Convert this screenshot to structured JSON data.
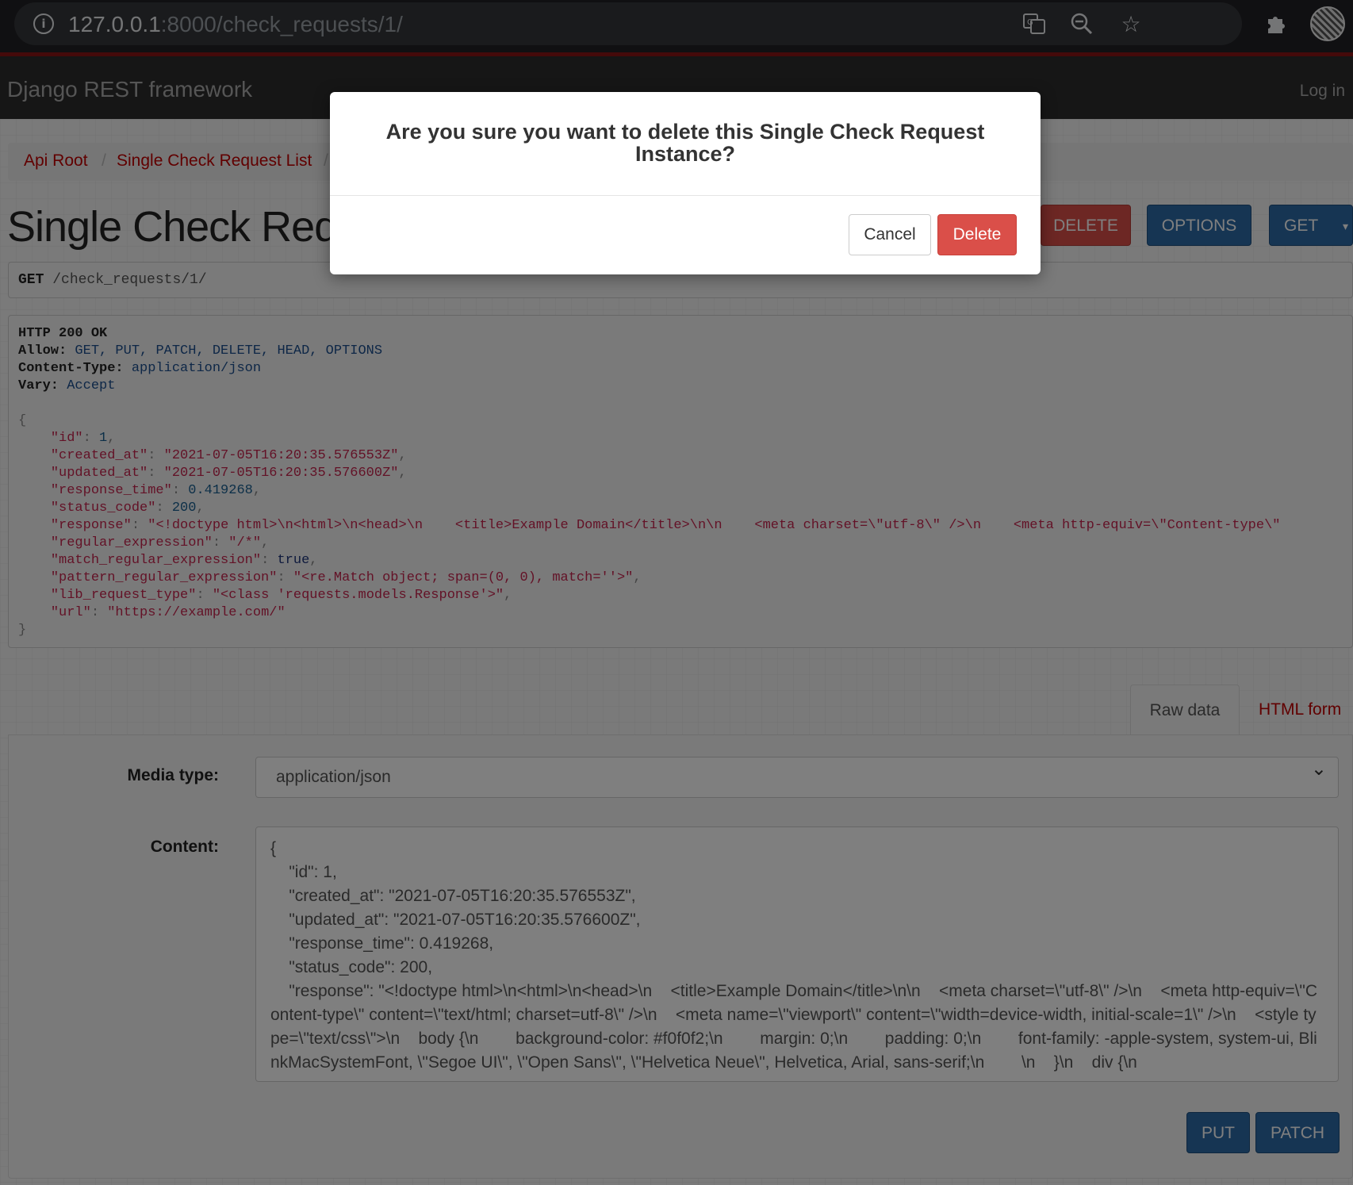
{
  "browser": {
    "url_host": "127.0.0.1",
    "url_rest": ":8000/check_requests/1/"
  },
  "navbar": {
    "brand": "Django REST framework",
    "login": "Log in"
  },
  "breadcrumb": {
    "items": [
      "Api Root",
      "Single Check Request List"
    ],
    "separator": "/"
  },
  "page": {
    "title": "Single Check Request Instance",
    "buttons": {
      "delete": "DELETE",
      "options": "OPTIONS",
      "get": "GET"
    },
    "request_method": "GET",
    "request_path": "/check_requests/1/"
  },
  "response": {
    "status": "HTTP 200 OK",
    "headers": [
      {
        "name": "Allow:",
        "value": "GET, PUT, PATCH, DELETE, HEAD, OPTIONS"
      },
      {
        "name": "Content-Type:",
        "value": "application/json"
      },
      {
        "name": "Vary:",
        "value": "Accept"
      }
    ],
    "body": {
      "id": "1",
      "created_at": "\"2021-07-05T16:20:35.576553Z\"",
      "updated_at": "\"2021-07-05T16:20:35.576600Z\"",
      "response_time": "0.419268",
      "status_code": "200",
      "response": "\"<!doctype html>\\n<html>\\n<head>\\n    <title>Example Domain</title>\\n\\n    <meta charset=\\\"utf-8\\\" />\\n    <meta http-equiv=\\\"Content-type\\\"",
      "regular_expression": "\"/*\"",
      "match_regular_expression": "true",
      "pattern_regular_expression": "\"<re.Match object; span=(0, 0), match=''>\"",
      "lib_request_type": "\"<class 'requests.models.Response'>\"",
      "url": "\"https://example.com/\""
    }
  },
  "form": {
    "tabs": {
      "raw": "Raw data",
      "html": "HTML form"
    },
    "media_type_label": "Media type:",
    "media_type_value": "application/json",
    "content_label": "Content:",
    "content_value": "{\n    \"id\": 1,\n    \"created_at\": \"2021-07-05T16:20:35.576553Z\",\n    \"updated_at\": \"2021-07-05T16:20:35.576600Z\",\n    \"response_time\": 0.419268,\n    \"status_code\": 200,\n    \"response\": \"<!doctype html>\\n<html>\\n<head>\\n    <title>Example Domain</title>\\n\\n    <meta charset=\\\"utf-8\\\" />\\n    <meta http-equiv=\\\"Content-type\\\" content=\\\"text/html; charset=utf-8\\\" />\\n    <meta name=\\\"viewport\\\" content=\\\"width=device-width, initial-scale=1\\\" />\\n    <style type=\\\"text/css\\\">\\n    body {\\n        background-color: #f0f0f2;\\n        margin: 0;\\n        padding: 0;\\n        font-family: -apple-system, system-ui, BlinkMacSystemFont, \\\"Segoe UI\\\", \\\"Open Sans\\\", \\\"Helvetica Neue\\\", Helvetica, Arial, sans-serif;\\n        \\n    }\\n    div {\\n",
    "put": "PUT",
    "patch": "PATCH"
  },
  "modal": {
    "title": "Are you sure you want to delete this Single Check Request Instance?",
    "cancel": "Cancel",
    "delete": "Delete"
  },
  "colors": {
    "danger": "#da4f49",
    "primary": "#2c6aa6",
    "link": "#c20000",
    "navbar": "#2c2c2c"
  }
}
